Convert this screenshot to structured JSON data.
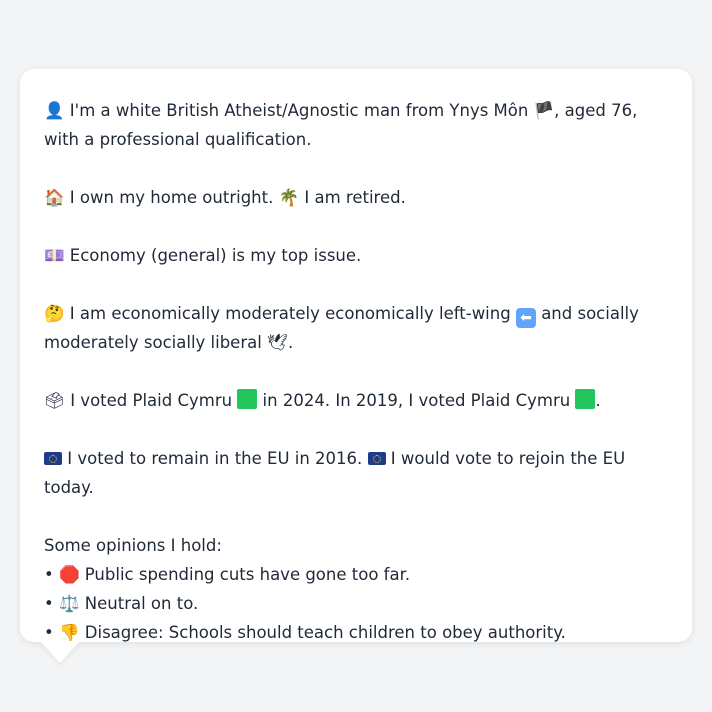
{
  "profile": {
    "line1": {
      "icon": "👤",
      "text_a": " I'm a white British Atheist/Agnostic man from Ynys Môn ",
      "flag_icon": "🏴",
      "text_b": ", aged 76, with a professional qualification."
    },
    "line2": {
      "home_icon": "🏠",
      "home_text": " I own my home outright. ",
      "retired_icon": "🌴",
      "retired_text": " I am retired."
    },
    "line3": {
      "icon": "💷",
      "text": " Economy (general) is my top issue."
    },
    "line4": {
      "icon": "🤔",
      "text_a": " I am economically moderately economically left-wing ",
      "arrow_icon": "⬅",
      "text_b": " and socially moderately socially liberal ",
      "dove_icon": "🕊",
      "text_c": "."
    },
    "line5": {
      "icon": "🗳",
      "text_a": " I voted Plaid Cymru ",
      "text_b": " in 2024. In 2019, I voted Plaid Cymru ",
      "text_c": "."
    },
    "line6": {
      "text_a": " I voted to remain in the EU in 2016. ",
      "text_b": " I would vote to rejoin the EU today."
    }
  },
  "opinions": {
    "heading": "Some opinions I hold:",
    "bullet": "• ",
    "items": [
      {
        "icon": "🛑",
        "text": " Public spending cuts have gone too far."
      },
      {
        "icon": "⚖️",
        "text": " Neutral on to."
      },
      {
        "icon": "👎",
        "text": " Disagree: Schools should teach children to obey authority."
      }
    ]
  },
  "colors": {
    "background": "#f3f4f6",
    "bubble": "#ffffff",
    "text": "#1f2937",
    "party_green": "#22c55e",
    "eu_blue": "#1e3a8a"
  }
}
